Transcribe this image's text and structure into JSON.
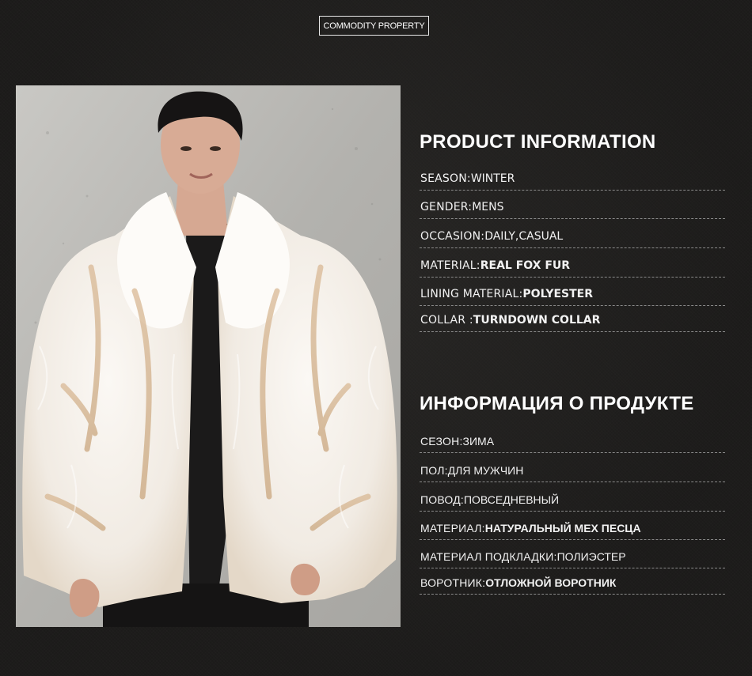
{
  "badge": "COMMODITY PROPERTY",
  "photo": {
    "icon": "product-photo-man-in-white-fox-fur-coat"
  },
  "en": {
    "title": "PRODUCT INFORMATION",
    "rows": [
      {
        "key": "SEASON:  ",
        "value": "WINTER",
        "bold": false
      },
      {
        "key": "GENDER:",
        "value": "MENS",
        "bold": false
      },
      {
        "key": "OCCASION:",
        "value": "DAILY,CASUAL",
        "bold": false
      },
      {
        "key": "MATERIAL:  ",
        "value": "REAL FOX FUR",
        "bold": true
      },
      {
        "key": "LINING MATERIAL:",
        "value": "POLYESTER",
        "bold": true
      },
      {
        "key": "COLLAR : ",
        "value": "TURNDOWN COLLAR",
        "bold": true
      }
    ]
  },
  "ru": {
    "title": "ИНФОРМАЦИЯ О ПРОДУКТЕ",
    "rows": [
      {
        "key": "СЕЗОН: ",
        "value": "ЗИМА",
        "bold": false
      },
      {
        "key": "ПОЛ:  ",
        "value": "ДЛЯ МУЖЧИН",
        "bold": false
      },
      {
        "key": "ПОВОД: ",
        "value": "ПОВСЕДНЕВНЫЙ",
        "bold": false
      },
      {
        "key": "МАТЕРИАЛ:  ",
        "value": "НАТУРАЛЬНЫЙ МЕХ ПЕСЦА",
        "bold": true
      },
      {
        "key": "МАТЕРИАЛ ПОДКЛАДКИ:  ",
        "value": "ПОЛИЭСТЕР",
        "bold": false
      },
      {
        "key": "ВОРОТНИК:  ",
        "value": "ОТЛОЖНОЙ ВОРОТНИК",
        "bold": true
      }
    ]
  }
}
